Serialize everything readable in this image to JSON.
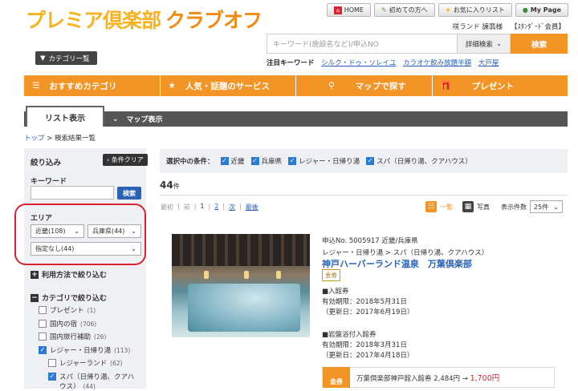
{
  "logo": {
    "part1": "プレミア倶楽部",
    "part2": "クラブオフ"
  },
  "topnav": [
    {
      "label": "HOME",
      "icon": "home-icon"
    },
    {
      "label": "初めての方へ",
      "icon": "pencil-icon"
    },
    {
      "label": "お気に入りリスト",
      "icon": "star-icon"
    },
    {
      "label": "My Page",
      "icon": "person-icon"
    }
  ],
  "user": {
    "name": "咲ランド 諌翡様",
    "level": "【ｽﾀﾝﾀﾞｰﾄﾞ会員】"
  },
  "category_button": "カテゴリー覧",
  "search": {
    "placeholder": "キーワード(施設名など)/申込NO",
    "detail": "詳細検索",
    "button": "検索"
  },
  "keywords": {
    "label": "注目キーワード",
    "items": [
      "シルク・ドゥ・ソレイユ",
      "カラオケ飲み放題半額",
      "大戸屋"
    ]
  },
  "orange_nav": [
    {
      "label": "おすすめカテゴリ",
      "icon": "menu-icon"
    },
    {
      "label": "人気・話題のサービス",
      "icon": "star-icon"
    },
    {
      "label": "マップで探す",
      "icon": "pin-icon"
    },
    {
      "label": "プレゼント",
      "icon": "gift-icon"
    }
  ],
  "tabs": {
    "list": "リスト表示",
    "map": "マップ表示"
  },
  "breadcrumb": {
    "top": "トップ",
    "sep": ">",
    "current": "検索結果一覧"
  },
  "sidebar": {
    "narrow": "絞り込み",
    "clear": "条件クリア",
    "keyword": "キーワード",
    "search_btn": "検索",
    "area": "エリア",
    "region": "近畿(108)",
    "pref": "兵庫県(44)",
    "city": "指定なし(44)",
    "usage": "利用方法で絞り込む",
    "category": "カテゴリで絞り込む",
    "cats": [
      {
        "label": "プレゼント",
        "count": "(1)",
        "checked": false
      },
      {
        "label": "国内の宿",
        "count": "(706)",
        "checked": false
      },
      {
        "label": "国内旅行補助",
        "count": "(26)",
        "checked": false
      },
      {
        "label": "レジャー・日帰り湯",
        "count": "(113)",
        "checked": true
      },
      {
        "label": "レジャーランド",
        "count": "(62)",
        "checked": false
      },
      {
        "label": "スパ（日帰り湯、クアハ",
        "count": "",
        "checked": true
      },
      {
        "label": "ウス）",
        "count": "(44)",
        "checked": false
      }
    ]
  },
  "conditions": {
    "label": "選択中の条件：",
    "items": [
      "近畿",
      "兵庫県",
      "レジャー・日帰り湯",
      "スパ（日帰り湯、クアハウス）"
    ]
  },
  "result": {
    "count": "44",
    "unit": "件"
  },
  "pager": {
    "first": "最初",
    "prev": "前",
    "current": "1",
    "next_page": "2",
    "next": "次",
    "last": "最後"
  },
  "view": {
    "list": "一覧",
    "photo": "写真",
    "per_page_label": "表示件数",
    "per_page": "25件"
  },
  "item": {
    "no": "申込No. 5005917 近畿/兵庫県",
    "cat": "レジャー・日帰り湯 > スパ（日帰り湯、クアハウス）",
    "title": "神戸ハーバーランド温泉　万葉倶楽部",
    "badge": "金券",
    "t1": "■入館券",
    "t1a": "有効期限：2018年5月31日",
    "t1b": "（更新日：2017年6月19日）",
    "t2": "■岩盤浴付入館券",
    "t2a": "有効期限：2018年3月31日",
    "t2b": "（更新日：2017年4月18日）",
    "ticket_tag": "金券",
    "ticket_text": "万葉倶楽部神戸館入館券 2,484円 →",
    "ticket_price": "1,700円"
  }
}
